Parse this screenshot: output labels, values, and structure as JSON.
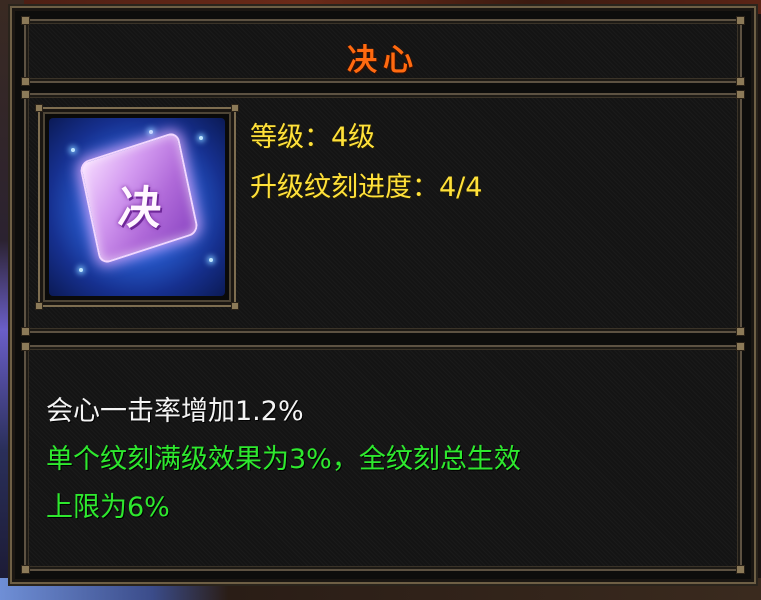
{
  "tooltip": {
    "title": "决心",
    "icon": {
      "name": "jueqing-rune-icon",
      "glyph": "决"
    },
    "info": {
      "level_line": "等级：4级",
      "progress_line": "升级纹刻进度：4/4"
    },
    "description": {
      "effect_line": "会心一击率增加1.2%",
      "note_line_1": "单个纹刻满级效果为3%，全纹刻总生效",
      "note_line_2": "上限为6%"
    }
  },
  "colors": {
    "title": "#ff6a10",
    "info_text": "#ffe13a",
    "effect_text": "#f4f4f4",
    "note_text": "#2ee82e",
    "frame": "#6e5f45"
  }
}
